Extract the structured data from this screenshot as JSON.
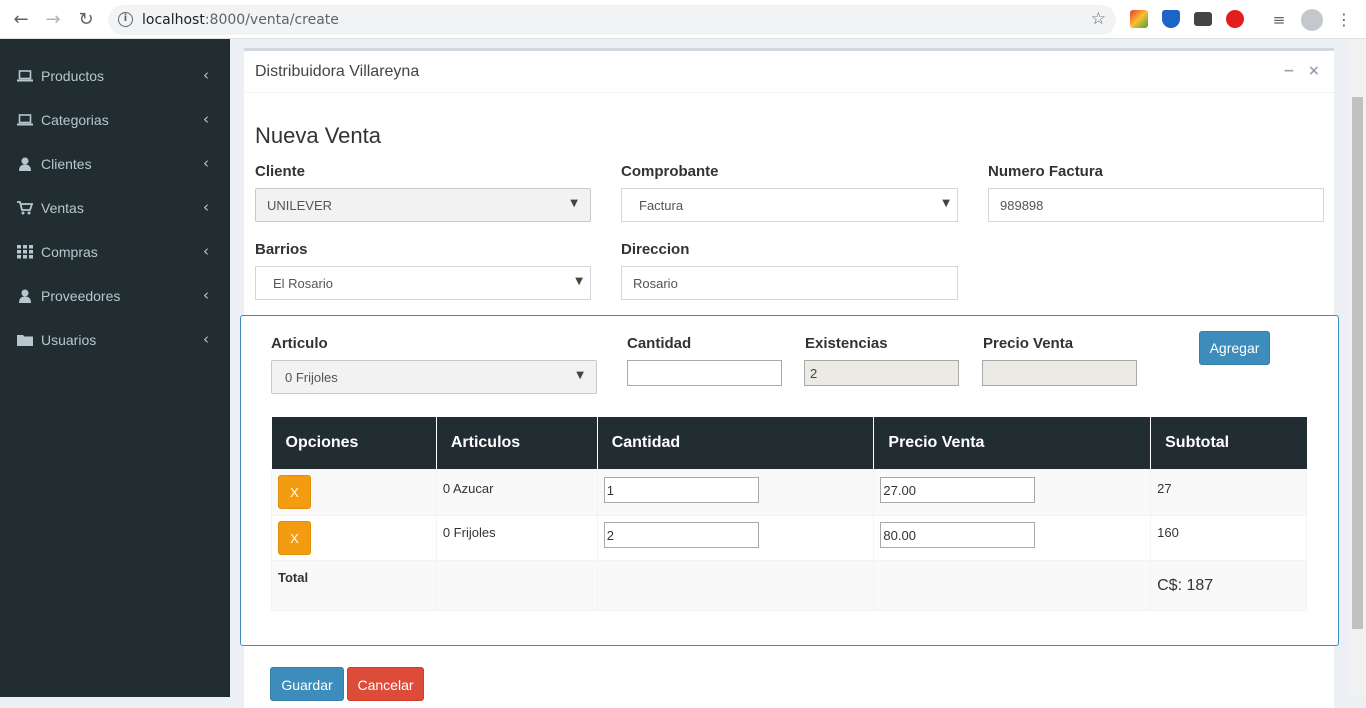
{
  "browser": {
    "url_host": "localhost",
    "url_rest": ":8000/venta/create"
  },
  "sidebar": {
    "items": [
      {
        "label": "Productos",
        "icon": "laptop-icon"
      },
      {
        "label": "Categorias",
        "icon": "laptop-icon"
      },
      {
        "label": "Clientes",
        "icon": "user-icon"
      },
      {
        "label": "Ventas",
        "icon": "cart-icon"
      },
      {
        "label": "Compras",
        "icon": "grid-icon"
      },
      {
        "label": "Proveedores",
        "icon": "user-icon"
      },
      {
        "label": "Usuarios",
        "icon": "folder-icon"
      }
    ]
  },
  "box": {
    "title": "Distribuidora Villareyna",
    "minimize": "−",
    "close": "×"
  },
  "form": {
    "heading": "Nueva Venta",
    "cliente_label": "Cliente",
    "cliente_value": "UNILEVER",
    "comprobante_label": "Comprobante",
    "comprobante_value": "Factura",
    "numero_label": "Numero Factura",
    "numero_value": "989898",
    "barrios_label": "Barrios",
    "barrios_value": "El Rosario",
    "direccion_label": "Direccion",
    "direccion_value": "Rosario"
  },
  "detalle": {
    "articulo_label": "Articulo",
    "articulo_value": "0 Frijoles",
    "cantidad_label": "Cantidad",
    "cantidad_value": "",
    "existencias_label": "Existencias",
    "existencias_value": "2",
    "precio_label": "Precio Venta",
    "precio_value": "",
    "agregar_label": "Agregar"
  },
  "table": {
    "headers": [
      "Opciones",
      "Articulos",
      "Cantidad",
      "Precio Venta",
      "Subtotal"
    ],
    "rows": [
      {
        "remove": "X",
        "articulo": "0 Azucar",
        "cantidad": "1",
        "precio": "27.00",
        "subtotal": "27"
      },
      {
        "remove": "X",
        "articulo": "0 Frijoles",
        "cantidad": "2",
        "precio": "80.00",
        "subtotal": "160"
      }
    ],
    "total_label": "Total",
    "total_value": "C$: 187"
  },
  "actions": {
    "guardar": "Guardar",
    "cancelar": "Cancelar"
  },
  "colors": {
    "sidebar": "#222d32",
    "primary": "#3c8dbc",
    "danger": "#dd4b39",
    "warning": "#f39c12"
  }
}
